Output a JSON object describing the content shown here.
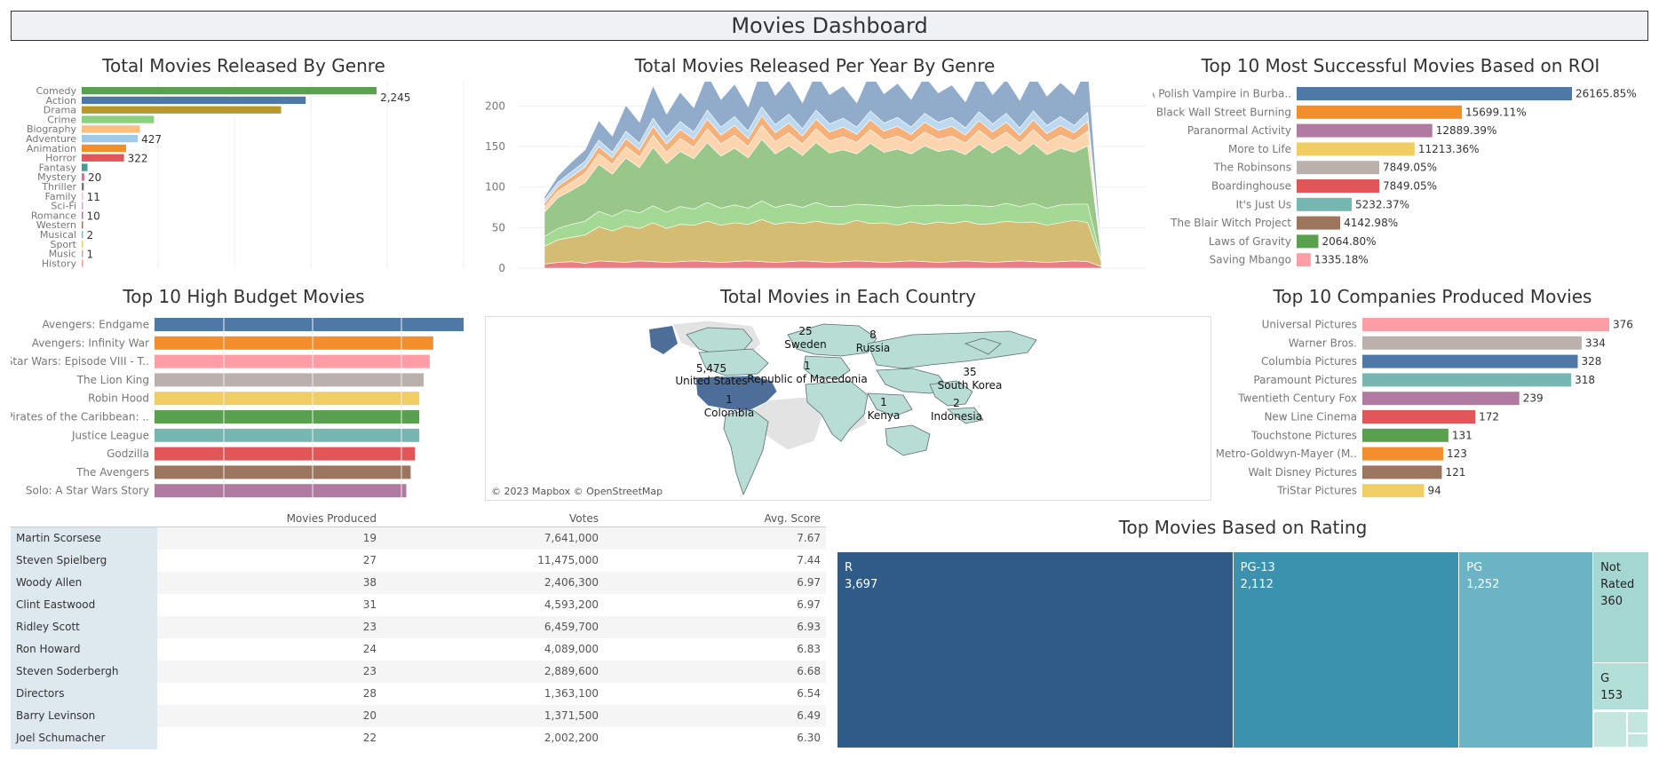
{
  "dashboard_title": "Movies Dashboard",
  "panels": {
    "genre_total": "Total Movies Released By Genre",
    "year_genre": "Total Movies Released Per Year By Genre",
    "roi": "Top 10 Most Successful Movies Based on ROI",
    "budget": "Top 10 High Budget Movies",
    "country": "Total Movies in Each Country",
    "companies": "Top 10 Companies Produced Movies",
    "rating": "Top Movies Based on Rating"
  },
  "map": {
    "credit": "© 2023 Mapbox © OpenStreetMap",
    "labels": [
      {
        "name": "United States",
        "value": "5,475"
      },
      {
        "name": "Sweden",
        "value": "25"
      },
      {
        "name": "Russia",
        "value": "8"
      },
      {
        "name": "Republic of Macedonia",
        "value": "1"
      },
      {
        "name": "South Korea",
        "value": "35"
      },
      {
        "name": "Colombia",
        "value": "1"
      },
      {
        "name": "Kenya",
        "value": "1"
      },
      {
        "name": "Indonesia",
        "value": "2"
      }
    ]
  },
  "table": {
    "headers": [
      "Movies Produced",
      "Votes",
      "Avg. Score"
    ],
    "rows": [
      {
        "name": "Martin Scorsese",
        "movies": "19",
        "votes": "7,641,000",
        "score": "7.67"
      },
      {
        "name": "Steven Spielberg",
        "movies": "27",
        "votes": "11,475,000",
        "score": "7.44"
      },
      {
        "name": "Woody Allen",
        "movies": "38",
        "votes": "2,406,300",
        "score": "6.97"
      },
      {
        "name": "Clint Eastwood",
        "movies": "31",
        "votes": "4,593,200",
        "score": "6.97"
      },
      {
        "name": "Ridley Scott",
        "movies": "23",
        "votes": "6,459,700",
        "score": "6.93"
      },
      {
        "name": "Ron Howard",
        "movies": "24",
        "votes": "4,089,000",
        "score": "6.83"
      },
      {
        "name": "Steven Soderbergh",
        "movies": "23",
        "votes": "2,889,600",
        "score": "6.68"
      },
      {
        "name": "Directors",
        "movies": "28",
        "votes": "1,363,100",
        "score": "6.54"
      },
      {
        "name": "Barry Levinson",
        "movies": "20",
        "votes": "1,371,500",
        "score": "6.49"
      },
      {
        "name": "Joel Schumacher",
        "movies": "22",
        "votes": "2,002,200",
        "score": "6.30"
      }
    ]
  },
  "chart_data": [
    {
      "id": "genre",
      "type": "bar",
      "categories": [
        "Comedy",
        "Action",
        "Drama",
        "Crime",
        "Biography",
        "Adventure",
        "Animation",
        "Horror",
        "Fantasy",
        "Mystery",
        "Thriller",
        "Family",
        "Sci-Fi",
        "Romance",
        "Western",
        "Musical",
        "Sport",
        "Music",
        "History"
      ],
      "values": [
        2245,
        1705,
        1518,
        550,
        443,
        427,
        338,
        322,
        44,
        20,
        16,
        11,
        10,
        10,
        3,
        2,
        1,
        1,
        1
      ],
      "data_labels": {
        "0": "2,245",
        "5": "427",
        "7": "322",
        "9": "20",
        "11": "11",
        "13": "10",
        "15": "2",
        "17": "1"
      },
      "colors": [
        "#59a14f",
        "#4e79a7",
        "#b6992d",
        "#8cd17d",
        "#ffbe7d",
        "#a0cbe8",
        "#f28e2b",
        "#e15759",
        "#499894",
        "#d37295",
        "#79706e",
        "#fabfd2",
        "#d4a6c8",
        "#b07aa1",
        "#9d7660",
        "#86bcb6",
        "#f1ce63",
        "#bab0ac",
        "#ff9d9a"
      ],
      "xmax": 2500
    },
    {
      "id": "area",
      "type": "area",
      "yticks": [
        0,
        50,
        100,
        150,
        200
      ],
      "ylim": [
        0,
        230
      ],
      "layers": [
        {
          "color": "#e8757e",
          "values": [
            5,
            7,
            8,
            6,
            9,
            8,
            7,
            9,
            8,
            7,
            8,
            9,
            8,
            7,
            8,
            9,
            8,
            7,
            8,
            9,
            8,
            7,
            8,
            9,
            8,
            7,
            8,
            9,
            8,
            7,
            8,
            9,
            8,
            7,
            8,
            9,
            8,
            7,
            8,
            9,
            8,
            2
          ]
        },
        {
          "color": "#d2b96b",
          "values": [
            22,
            28,
            30,
            35,
            42,
            38,
            45,
            40,
            48,
            42,
            46,
            44,
            50,
            46,
            48,
            45,
            52,
            47,
            49,
            46,
            50,
            48,
            46,
            50,
            47,
            49,
            45,
            48,
            46,
            50,
            47,
            49,
            46,
            48,
            50,
            47,
            49,
            46,
            48,
            50,
            48,
            6
          ]
        },
        {
          "color": "#9fd68f",
          "values": [
            12,
            14,
            16,
            17,
            19,
            18,
            20,
            19,
            21,
            20,
            22,
            20,
            23,
            21,
            22,
            20,
            23,
            21,
            22,
            20,
            23,
            21,
            22,
            20,
            23,
            21,
            22,
            20,
            23,
            21,
            22,
            20,
            23,
            21,
            22,
            20,
            23,
            21,
            22,
            20,
            23,
            3
          ]
        },
        {
          "color": "#93c383",
          "values": [
            30,
            38,
            42,
            48,
            58,
            52,
            64,
            56,
            72,
            60,
            68,
            62,
            74,
            64,
            70,
            62,
            76,
            66,
            72,
            64,
            74,
            66,
            70,
            62,
            76,
            66,
            72,
            64,
            74,
            66,
            70,
            62,
            76,
            66,
            72,
            64,
            74,
            66,
            70,
            64,
            72,
            5
          ]
        },
        {
          "color": "#fcd2aa",
          "values": [
            6,
            8,
            10,
            11,
            13,
            12,
            14,
            13,
            15,
            14,
            16,
            14,
            17,
            15,
            16,
            14,
            17,
            15,
            16,
            14,
            17,
            15,
            16,
            14,
            17,
            15,
            16,
            14,
            17,
            15,
            16,
            14,
            17,
            15,
            16,
            14,
            17,
            15,
            16,
            14,
            18,
            3
          ]
        },
        {
          "color": "#f4ad72",
          "values": [
            5,
            6,
            7,
            8,
            9,
            8,
            10,
            9,
            11,
            10,
            11,
            10,
            12,
            11,
            12,
            10,
            12,
            11,
            12,
            10,
            12,
            11,
            12,
            10,
            12,
            11,
            12,
            10,
            12,
            11,
            12,
            10,
            12,
            11,
            12,
            10,
            12,
            11,
            12,
            10,
            12,
            2
          ]
        },
        {
          "color": "#b9d7ee",
          "values": [
            4,
            5,
            6,
            7,
            8,
            7,
            9,
            8,
            10,
            9,
            10,
            9,
            11,
            10,
            11,
            9,
            11,
            10,
            11,
            9,
            11,
            10,
            11,
            9,
            11,
            10,
            11,
            9,
            11,
            10,
            11,
            9,
            11,
            10,
            11,
            9,
            11,
            10,
            11,
            9,
            11,
            2
          ]
        },
        {
          "color": "#8ba6c8",
          "values": [
            4,
            8,
            12,
            14,
            24,
            20,
            32,
            26,
            40,
            28,
            36,
            30,
            44,
            34,
            40,
            30,
            48,
            36,
            42,
            32,
            46,
            36,
            40,
            30,
            48,
            36,
            42,
            34,
            46,
            36,
            40,
            32,
            48,
            36,
            42,
            34,
            46,
            36,
            42,
            38,
            58,
            4
          ]
        }
      ]
    },
    {
      "id": "roi",
      "type": "bar",
      "categories": [
        "A Polish Vampire in Burba..",
        "Black Wall Street Burning",
        "Paranormal Activity",
        "More to Life",
        "The Robinsons",
        "Boardinghouse",
        "It's Just Us",
        "The Blair Witch Project",
        "Laws of Gravity",
        "Saving Mbango"
      ],
      "values": [
        26165.85,
        15699.11,
        12889.39,
        11213.36,
        7849.05,
        7849.05,
        5232.37,
        4142.98,
        2064.8,
        1335.18
      ],
      "data_labels": [
        "26165.85%",
        "15699.11%",
        "12889.39%",
        "11213.36%",
        "7849.05%",
        "7849.05%",
        "5232.37%",
        "4142.98%",
        "2064.80%",
        "1335.18%"
      ],
      "colors": [
        "#4e79a7",
        "#f28e2b",
        "#b07aa1",
        "#f1ce63",
        "#bab0ac",
        "#e15759",
        "#76b7b2",
        "#9c755f",
        "#59a14f",
        "#ff9da7"
      ]
    },
    {
      "id": "budget",
      "type": "bar",
      "categories": [
        "Avengers: Endgame",
        "Avengers: Infinity War",
        "Star Wars: Episode VIII - T..",
        "The Lion King",
        "Robin Hood",
        "Pirates of the Caribbean: ..",
        "Justice League",
        "Godzilla",
        "The Avengers",
        "Solo: A Star Wars Story"
      ],
      "values": [
        356,
        321,
        317,
        310,
        305,
        305,
        305,
        300,
        295,
        290
      ],
      "colors": [
        "#4e79a7",
        "#f28e2b",
        "#ff9da7",
        "#bab0ac",
        "#f1ce63",
        "#59a14f",
        "#76b7b2",
        "#e15759",
        "#9c755f",
        "#b07aa1"
      ]
    },
    {
      "id": "companies",
      "type": "bar",
      "categories": [
        "Universal Pictures",
        "Warner Bros.",
        "Columbia Pictures",
        "Paramount Pictures",
        "Twentieth Century Fox",
        "New Line Cinema",
        "Touchstone Pictures",
        "Metro-Goldwyn-Mayer (M..",
        "Walt Disney Pictures",
        "TriStar Pictures"
      ],
      "values": [
        376,
        334,
        328,
        318,
        239,
        172,
        131,
        123,
        121,
        94
      ],
      "data_labels": [
        "376",
        "334",
        "328",
        "318",
        "239",
        "172",
        "131",
        "123",
        "121",
        "94"
      ],
      "colors": [
        "#ff9da7",
        "#bab0ac",
        "#4e79a7",
        "#76b7b2",
        "#b07aa1",
        "#e15759",
        "#59a14f",
        "#f28e2b",
        "#9c755f",
        "#f1ce63"
      ]
    },
    {
      "id": "rating",
      "type": "treemap",
      "items": [
        {
          "label": "R",
          "value": 3697,
          "display": "3,697",
          "color": "#2e5b87"
        },
        {
          "label": "PG-13",
          "value": 2112,
          "display": "2,112",
          "color": "#3b92ae"
        },
        {
          "label": "PG",
          "value": 1252,
          "display": "1,252",
          "color": "#6ab4c5"
        },
        {
          "label": "Not Rated",
          "value": 360,
          "display": "360",
          "color": "#a4d6d2"
        },
        {
          "label": "G",
          "value": 153,
          "display": "153",
          "color": "#b3dfd9"
        }
      ]
    }
  ],
  "colors": {
    "bg": "#ffffff",
    "title_bar": "#eef2f4",
    "land": "#b8ddd4",
    "usa": "#4e6e9a"
  }
}
